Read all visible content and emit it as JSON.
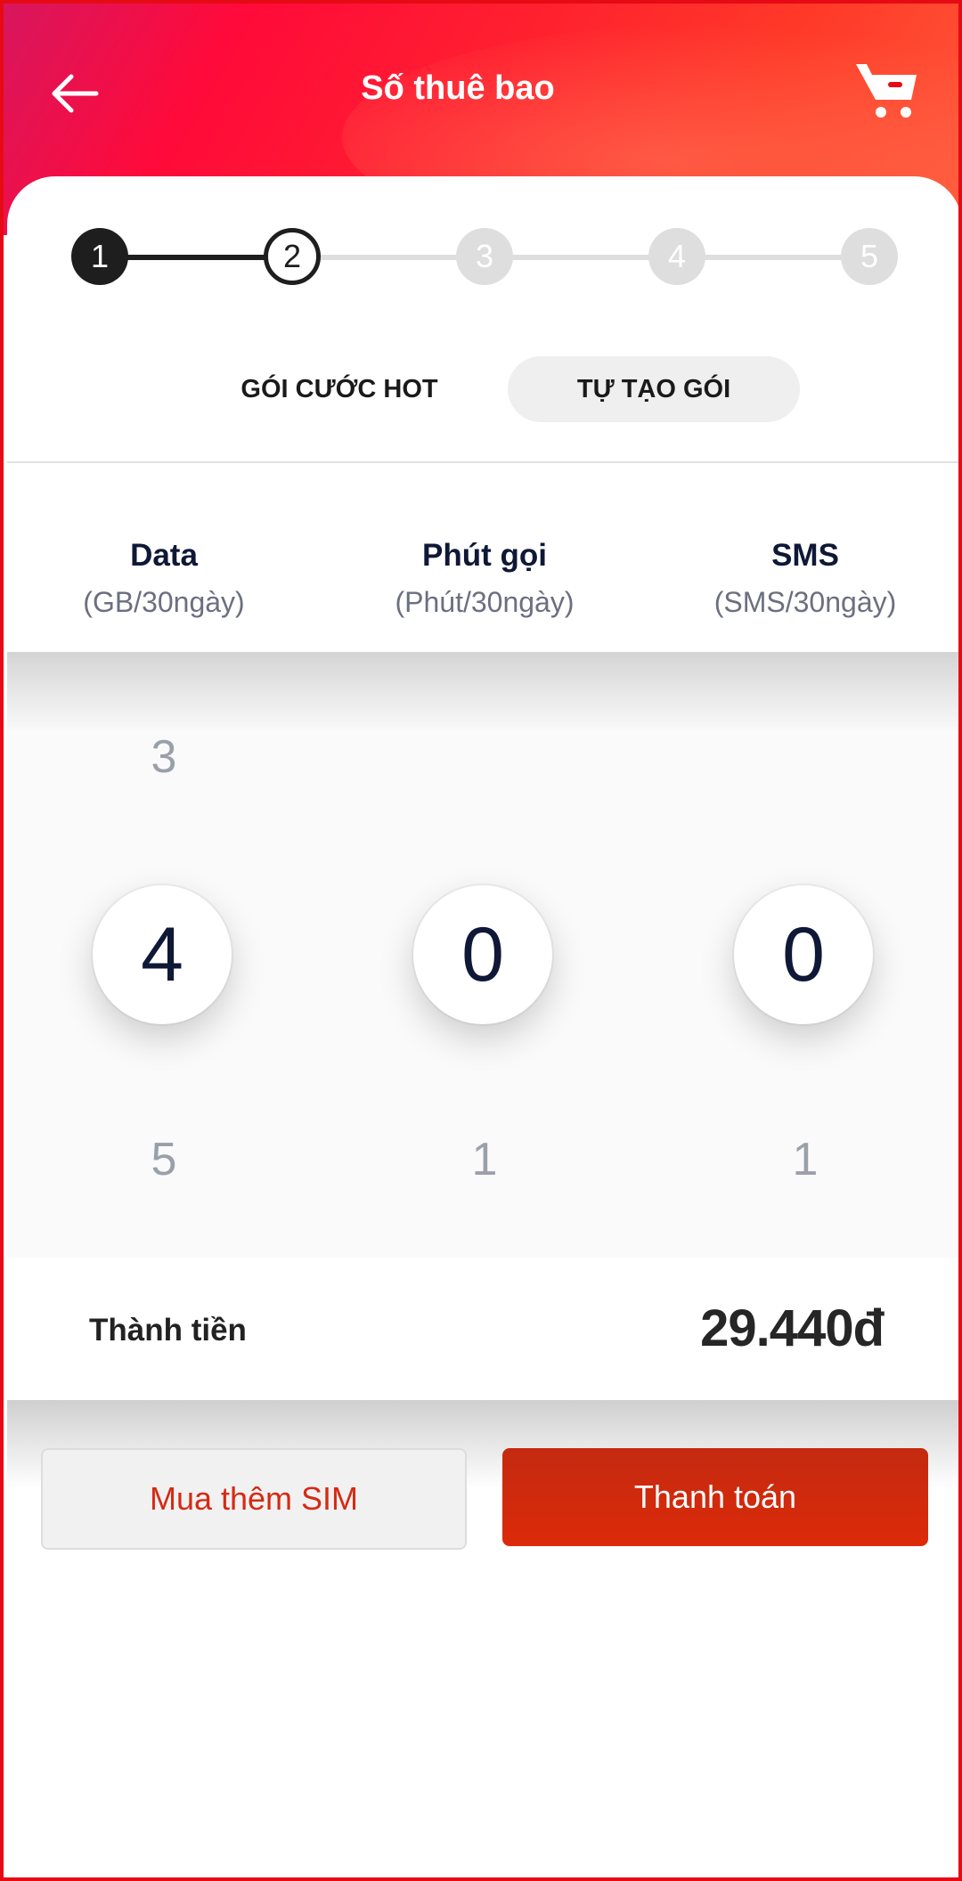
{
  "header": {
    "title": "Số thuê bao"
  },
  "stepper": {
    "steps": [
      "1",
      "2",
      "3",
      "4",
      "5"
    ],
    "current": 2
  },
  "tabs": [
    {
      "label": "GÓI CƯỚC HOT",
      "active": false
    },
    {
      "label": "TỰ TẠO GÓI",
      "active": true
    }
  ],
  "columns": [
    {
      "title": "Data",
      "unit": "(GB/30ngày)",
      "prev": "3",
      "value": "4",
      "next": "5"
    },
    {
      "title": "Phút gọi",
      "unit": "(Phút/30ngày)",
      "prev": "",
      "value": "0",
      "next": "1"
    },
    {
      "title": "SMS",
      "unit": "(SMS/30ngày)",
      "prev": "",
      "value": "0",
      "next": "1"
    }
  ],
  "total": {
    "label": "Thành tiền",
    "value": "29.440đ"
  },
  "buttons": {
    "buy_more": "Mua thêm SIM",
    "pay": "Thanh toán"
  },
  "colors": {
    "brand": "#e60a14",
    "pay_button": "#d22a0c",
    "text_dark": "#0f1836"
  },
  "icons": {
    "back": "arrow-left-icon",
    "cart": "cart-icon"
  }
}
